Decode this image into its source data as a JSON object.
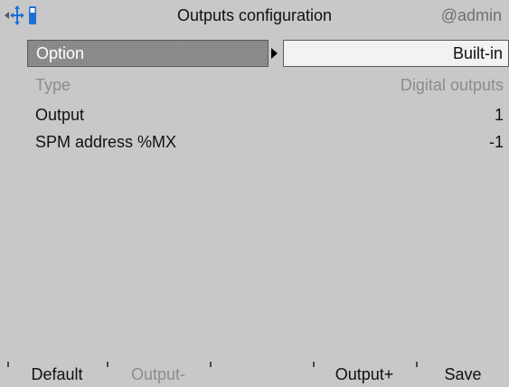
{
  "header": {
    "title": "Outputs configuration",
    "user": "@admin",
    "icons": [
      "left-arrow-icon",
      "network-icon",
      "usb-icon"
    ]
  },
  "rows": [
    {
      "label": "Option",
      "value": "Built-in",
      "selected": true
    },
    {
      "label": "Type",
      "value": "Digital outputs",
      "disabled": true
    },
    {
      "label": "Output",
      "value": "1"
    },
    {
      "label": "SPM address %MX",
      "value": "-1"
    }
  ],
  "footer": {
    "keys": [
      "Default",
      "Output-",
      "",
      "Output+",
      "Save"
    ]
  },
  "colors": {
    "background": "#c8c8c8",
    "selected_label_bg": "#8c8c8c",
    "value_cell_bg": "#f2f2f2",
    "disabled_text": "#8c8c8c",
    "usb_icon": "#1f6fd6"
  }
}
